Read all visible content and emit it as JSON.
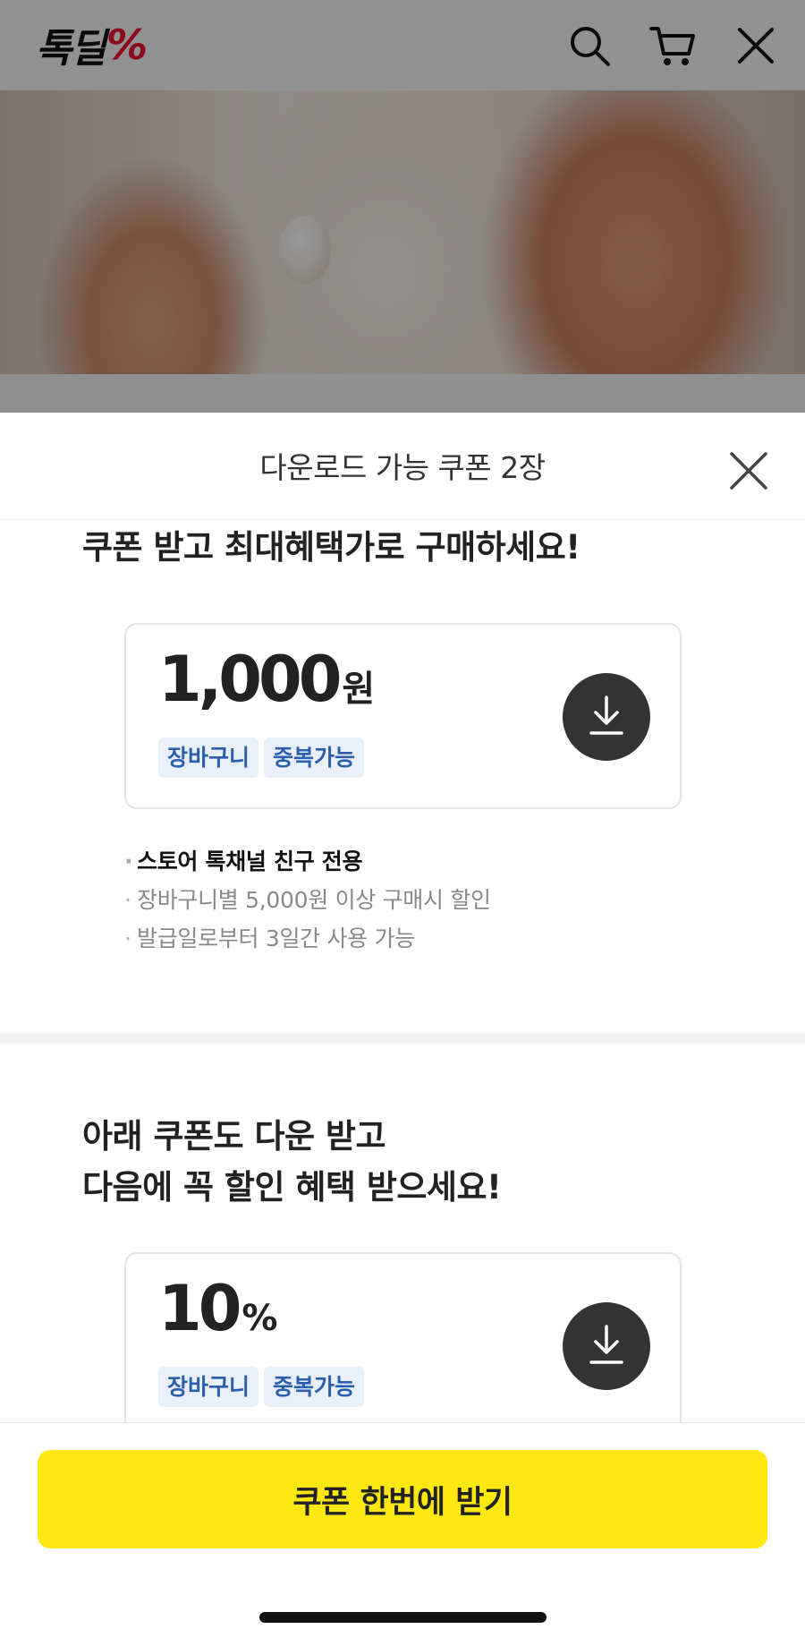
{
  "app": {
    "logo_text": "톡딜",
    "logo_mark": "%"
  },
  "header_icons": [
    "search-icon",
    "cart-icon",
    "close-icon"
  ],
  "hero": {
    "carousel_count": 6,
    "active_index": 0
  },
  "sheet": {
    "title": "다운로드 가능 쿠폰 2장",
    "close_icon": "close-icon",
    "section1": {
      "title": "쿠폰 받고 최대혜택가로 구매하세요!",
      "coupon": {
        "amount": "1,000",
        "unit": "원",
        "tags": [
          "장바구니",
          "중복가능"
        ],
        "download_icon": "download-icon"
      },
      "notes": [
        {
          "text": "스토어 톡채널 친구 전용",
          "strong": true
        },
        {
          "text": "장바구니별 5,000원 이상 구매시 할인",
          "strong": false
        },
        {
          "text": "발급일로부터 3일간 사용 가능",
          "strong": false
        }
      ]
    },
    "section2": {
      "title_line1": "아래 쿠폰도 다운 받고",
      "title_line2": "다음에 꼭 할인 혜택 받으세요!",
      "coupon": {
        "amount": "10",
        "unit": "%",
        "tags": [
          "장바구니",
          "중복가능"
        ],
        "download_icon": "download-icon"
      }
    },
    "cta_label": "쿠폰 한번에 받기"
  },
  "colors": {
    "cta_bg": "#ffe812",
    "tag_bg": "#e9f0fa",
    "tag_text": "#2a5fb0",
    "logo_accent": "#e8112d",
    "download_bg": "#333333"
  }
}
